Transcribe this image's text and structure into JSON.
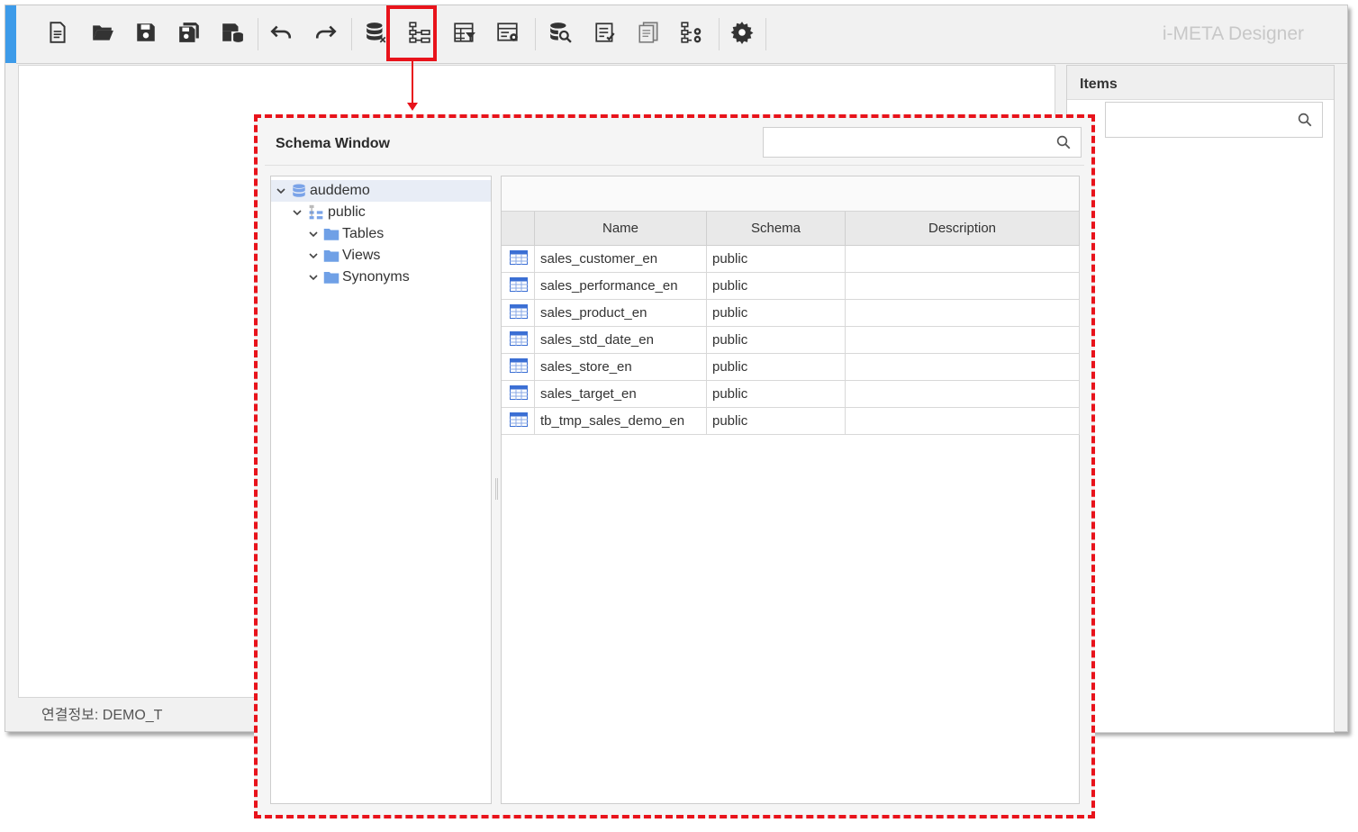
{
  "app": {
    "brand": "i-META Designer",
    "status_label": "연결정보: DEMO_T"
  },
  "toolbar": {
    "buttons": [
      {
        "name": "new-document-icon"
      },
      {
        "name": "open-folder-icon"
      },
      {
        "name": "save-icon"
      },
      {
        "name": "save-all-icon"
      },
      {
        "name": "save-to-database-icon"
      },
      {
        "name": "undo-icon"
      },
      {
        "name": "redo-icon"
      },
      {
        "name": "database-connection-icon"
      },
      {
        "name": "schema-window-icon"
      },
      {
        "name": "table-filter-icon"
      },
      {
        "name": "table-settings-icon"
      },
      {
        "name": "database-search-icon"
      },
      {
        "name": "checklist-icon"
      },
      {
        "name": "document-copy-icon"
      },
      {
        "name": "hierarchy-settings-icon"
      },
      {
        "name": "gear-icon"
      }
    ],
    "highlighted": "schema-window-icon",
    "highlight_color": "#e8131b"
  },
  "items_panel": {
    "title": "Items",
    "search_value": ""
  },
  "schema_window": {
    "title": "Schema Window",
    "search_value": "",
    "tree": [
      {
        "label": "auddemo",
        "icon": "database-icon",
        "selected": true
      },
      {
        "label": "public",
        "icon": "schema-icon"
      },
      {
        "label": "Tables",
        "icon": "folder-icon"
      },
      {
        "label": "Views",
        "icon": "folder-icon"
      },
      {
        "label": "Synonyms",
        "icon": "folder-icon"
      }
    ],
    "grid": {
      "columns": [
        "Name",
        "Schema",
        "Description"
      ],
      "rows": [
        {
          "name": "sales_customer_en",
          "schema": "public",
          "description": ""
        },
        {
          "name": "sales_performance_en",
          "schema": "public",
          "description": ""
        },
        {
          "name": "sales_product_en",
          "schema": "public",
          "description": ""
        },
        {
          "name": "sales_std_date_en",
          "schema": "public",
          "description": ""
        },
        {
          "name": "sales_store_en",
          "schema": "public",
          "description": ""
        },
        {
          "name": "sales_target_en",
          "schema": "public",
          "description": ""
        },
        {
          "name": "tb_tmp_sales_demo_en",
          "schema": "public",
          "description": ""
        }
      ]
    }
  },
  "colors": {
    "accent": "#3d9be9",
    "annotation": "#e8131b",
    "folder": "#6fa0e6",
    "table_icon": "#3b6fd4"
  }
}
